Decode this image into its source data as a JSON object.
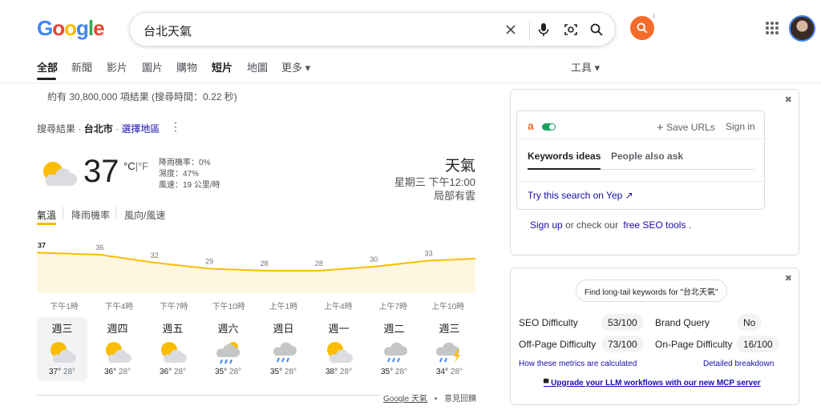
{
  "logo": [
    "G",
    "o",
    "o",
    "g",
    "l",
    "e"
  ],
  "search": {
    "query": "台北天氣"
  },
  "side_icon": {
    "info": "i"
  },
  "tabs": [
    "全部",
    "新聞",
    "影片",
    "圖片",
    "購物",
    "短片",
    "地圖",
    "更多 ▾"
  ],
  "tools": "工具 ▾",
  "stats": "約有 30,800,000 項結果 (搜尋時間：0.22 秒)",
  "breadcrumb": {
    "prefix": "搜尋結果 ·",
    "city": "台北市",
    "sep": "·",
    "change": "選擇地區"
  },
  "weather": {
    "temp": "37",
    "unit_c": "°C",
    "unit_sep": "|",
    "unit_f": "°F",
    "rain": "降雨機率：0%",
    "humidity": "濕度：47%",
    "wind": "風速：19 公里/時",
    "title": "天氣",
    "time": "星期三 下午12:00",
    "desc": "局部有雲",
    "tabs": [
      "氣溫",
      "降雨機率",
      "風向/風速"
    ]
  },
  "chart_data": {
    "type": "area",
    "x": [
      "下午1時",
      "下午4時",
      "下午7時",
      "下午10時",
      "上午1時",
      "上午4時",
      "上午7時",
      "上午10時"
    ],
    "values": [
      37,
      36,
      32,
      29,
      28,
      28,
      30,
      33
    ],
    "end_value": 34,
    "ylim": [
      20,
      40
    ],
    "color": "#fbbc05"
  },
  "forecast": [
    {
      "day": "週三",
      "icon": "partly-cloudy",
      "hi": "37°",
      "lo": "28°"
    },
    {
      "day": "週四",
      "icon": "partly-cloudy",
      "hi": "36°",
      "lo": "28°"
    },
    {
      "day": "週五",
      "icon": "partly-cloudy",
      "hi": "36°",
      "lo": "28°"
    },
    {
      "day": "週六",
      "icon": "rain-sun",
      "hi": "35°",
      "lo": "28°"
    },
    {
      "day": "週日",
      "icon": "rain",
      "hi": "35°",
      "lo": "28°"
    },
    {
      "day": "週一",
      "icon": "partly-cloudy",
      "hi": "38°",
      "lo": "28°"
    },
    {
      "day": "週二",
      "icon": "rain",
      "hi": "35°",
      "lo": "28°"
    },
    {
      "day": "週三",
      "icon": "thunderstorm",
      "hi": "34°",
      "lo": "28°"
    }
  ],
  "footer": {
    "source": "Google 天氣",
    "dot": "•",
    "feedback": "意見回饋"
  },
  "ahrefs": {
    "close": "✖",
    "brand": "a",
    "save_urls": "Save URLs",
    "sign_in": "Sign in",
    "tab_keywords": "Keywords ideas",
    "tab_people": "People also ask",
    "try_yep": "Try this search on Yep",
    "signup": "Sign up",
    "or_check": "or check our",
    "free_tools": "free SEO tools",
    "period": "."
  },
  "seo": {
    "close": "✖",
    "longtail": "Find long-tail keywords for \"台北天氣\"",
    "metrics": [
      {
        "label": "SEO Difficulty",
        "value": "53/100"
      },
      {
        "label": "Brand Query",
        "value": "No"
      },
      {
        "label": "Off-Page Difficulty",
        "value": "73/100"
      },
      {
        "label": "On-Page Difficulty",
        "value": "16/100"
      }
    ],
    "how_calc": "How these metrics are calculated",
    "detailed": "Detailed breakdown",
    "upgrade": "Upgrade your LLM workflows with our new MCP server"
  },
  "colors": {
    "accent": "#f46b2b",
    "link": "#1a0dab",
    "sun": "#fbbc05"
  }
}
